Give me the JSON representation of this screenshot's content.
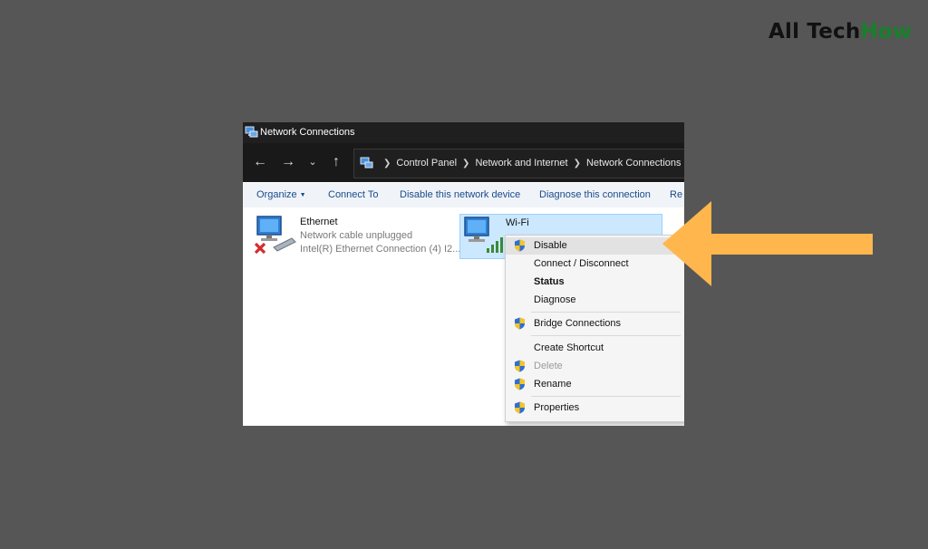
{
  "brand": {
    "part1": "All Tech",
    "part2": "How"
  },
  "window": {
    "title": "Network Connections",
    "breadcrumb": [
      "Control Panel",
      "Network and Internet",
      "Network Connections"
    ],
    "nav_icons": [
      "back-arrow-icon",
      "forward-arrow-icon",
      "recent-dropdown-icon",
      "up-arrow-icon"
    ]
  },
  "commands": {
    "organize": "Organize",
    "connect_to": "Connect To",
    "disable_device": "Disable this network device",
    "diagnose": "Diagnose this connection",
    "rename_partial": "Re"
  },
  "connections": {
    "ethernet": {
      "name": "Ethernet",
      "status": "Network cable unplugged",
      "device": "Intel(R) Ethernet Connection (4) I2..."
    },
    "wifi": {
      "name": "Wi-Fi"
    }
  },
  "context_menu": {
    "items": [
      {
        "label": "Disable",
        "shield": true,
        "highlighted": true
      },
      {
        "label": "Connect / Disconnect"
      },
      {
        "label": "Status",
        "bold": true
      },
      {
        "label": "Diagnose"
      },
      {
        "label": "Bridge Connections",
        "shield": true
      },
      {
        "label": "Create Shortcut"
      },
      {
        "label": "Delete",
        "shield": true,
        "disabled": true
      },
      {
        "label": "Rename",
        "shield": true
      },
      {
        "label": "Properties",
        "shield": true
      }
    ]
  },
  "colors": {
    "background": "#565656",
    "brand_green": "#1a7f2c",
    "annotation_arrow": "#ffb74d",
    "selection": "#cce8ff",
    "link_blue": "#1a4a8a"
  }
}
